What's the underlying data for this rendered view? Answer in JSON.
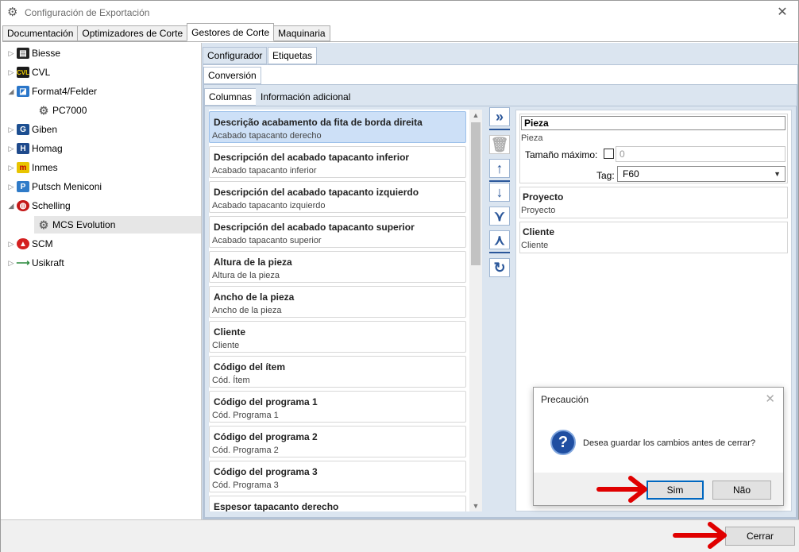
{
  "window": {
    "title": "Configuración de Exportación"
  },
  "top_tabs": [
    "Documentación",
    "Optimizadores de Corte",
    "Gestores de Corte",
    "Maquinaria"
  ],
  "tree": {
    "items": [
      {
        "label": "Biesse",
        "icon": "biesse-icon",
        "expanded": false
      },
      {
        "label": "CVL",
        "icon": "cvl-icon",
        "expanded": false
      },
      {
        "label": "Format4/Felder",
        "icon": "format4-icon",
        "expanded": true
      },
      {
        "label": "PC7000",
        "icon": "gear-icon",
        "child": true
      },
      {
        "label": "Giben",
        "icon": "giben-icon",
        "expanded": false
      },
      {
        "label": "Homag",
        "icon": "homag-icon",
        "expanded": false
      },
      {
        "label": "Inmes",
        "icon": "inmes-icon",
        "expanded": false
      },
      {
        "label": "Putsch Meniconi",
        "icon": "putsch-icon",
        "expanded": false
      },
      {
        "label": "Schelling",
        "icon": "schelling-icon",
        "expanded": true
      },
      {
        "label": "MCS Evolution",
        "icon": "gear-icon",
        "child": true,
        "selected": true
      },
      {
        "label": "SCM",
        "icon": "scm-icon",
        "expanded": false
      },
      {
        "label": "Usikraft",
        "icon": "usikraft-icon",
        "expanded": false
      }
    ]
  },
  "sub_tabs": [
    "Configurador",
    "Etiquetas"
  ],
  "conversion_tab": "Conversión",
  "inner_tabs": [
    "Columnas",
    "Información adicional"
  ],
  "columns": [
    {
      "title": "Descrição acabamento da fita de borda direita",
      "sub": "Acabado tapacanto derecho",
      "selected": true
    },
    {
      "title": "Descripción del acabado tapacanto inferior",
      "sub": "Acabado tapacanto inferior"
    },
    {
      "title": "Descripción del acabado tapacanto izquierdo",
      "sub": "Acabado tapacanto izquierdo"
    },
    {
      "title": "Descripción del acabado tapacanto superior",
      "sub": "Acabado tapacanto superior"
    },
    {
      "title": "Altura de la pieza",
      "sub": "Altura de la pieza"
    },
    {
      "title": "Ancho de la pieza",
      "sub": "Ancho de la pieza"
    },
    {
      "title": "Cliente",
      "sub": "Cliente"
    },
    {
      "title": "Código del ítem",
      "sub": "Cód. Ítem"
    },
    {
      "title": "Código del programa 1",
      "sub": "Cód. Programa 1"
    },
    {
      "title": "Código del programa 2",
      "sub": "Cód. Programa 2"
    },
    {
      "title": "Código del programa 3",
      "sub": "Cód. Programa 3"
    },
    {
      "title": "Espesor tapacanto derecho",
      "sub": ""
    }
  ],
  "toolbar_icons": [
    "move-all-right-icon",
    "delete-icon",
    "move-up-icon",
    "move-down-icon",
    "merge-down-icon",
    "split-up-icon",
    "refresh-icon"
  ],
  "properties": {
    "selected_name": "Pieza",
    "selected_sub": "Pieza",
    "max_size_label": "Tamaño máximo:",
    "max_size_value": "0",
    "tag_label": "Tag:",
    "tag_value": "F60",
    "fields": [
      {
        "title": "Proyecto",
        "sub": "Proyecto"
      },
      {
        "title": "Cliente",
        "sub": "Cliente"
      }
    ]
  },
  "dialog": {
    "title": "Precaución",
    "message": "Desea guardar los cambios antes de cerrar?",
    "yes_label": "Sim",
    "no_label": "Não"
  },
  "footer": {
    "close_label": "Cerrar"
  },
  "colors": {
    "accent": "#2b579a",
    "annotation_arrow": "#e00000",
    "selection": "#cde0f7"
  }
}
